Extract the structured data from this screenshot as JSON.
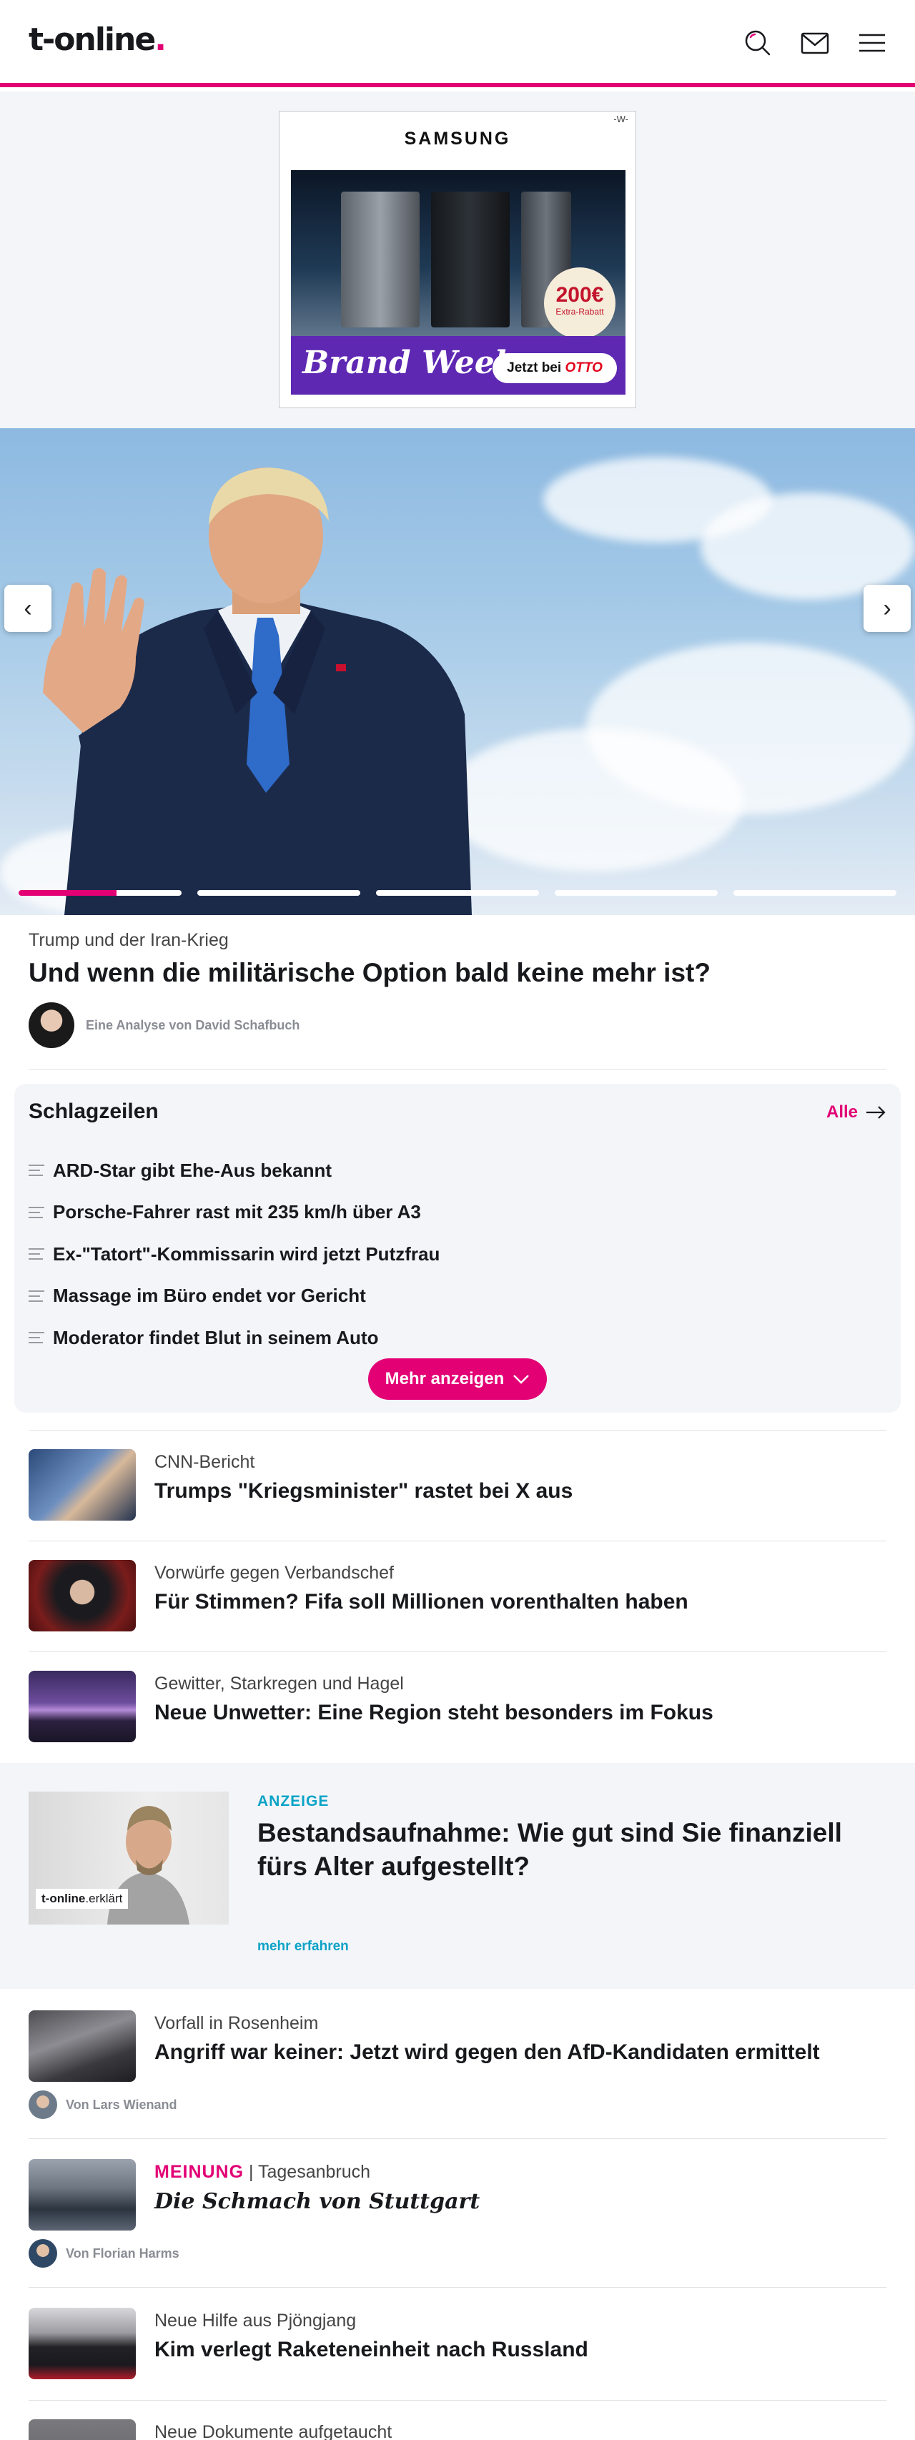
{
  "header": {
    "logo_text": "t-online",
    "logo_dot": ".",
    "icons": [
      "search-icon",
      "mail-icon",
      "menu-icon"
    ]
  },
  "ad": {
    "marker": "-W-",
    "brand": "SAMSUNG",
    "badge_value": "200€",
    "badge_text": "Extra-Rabatt",
    "campaign": "Brand Week",
    "cta_prefix": "Jetzt bei",
    "cta_brand": "OTTO"
  },
  "hero": {
    "slides_total": 5,
    "active_slide": 1,
    "active_progress": 0.6,
    "kicker": "Trump und der Iran-Krieg",
    "title": "Und wenn die militärische Option bald keine mehr ist?",
    "author": "Eine Analyse von David Schafbuch"
  },
  "headlines": {
    "heading": "Schlagzeilen",
    "all_label": "Alle",
    "items": [
      "ARD-Star gibt Ehe-Aus bekannt",
      "Porsche-Fahrer rast mit 235 km/h über A3",
      "Ex-\"Tatort\"-Kommissarin wird jetzt Putzfrau",
      "Massage im Büro endet vor Gericht",
      "Moderator findet Blut in seinem Auto"
    ],
    "more_label": "Mehr anzeigen"
  },
  "teasers": [
    {
      "kicker": "CNN-Bericht",
      "title": "Trumps \"Kriegsminister\" rastet bei X aus"
    },
    {
      "kicker": "Vorwürfe gegen Verbandschef",
      "title": "Für Stimmen? Fifa soll Millionen vorenthalten haben"
    },
    {
      "kicker": "Gewitter, Starkregen und Hagel",
      "title": "Neue Unwetter: Eine Region steht besonders im Fokus"
    }
  ],
  "sponsored": {
    "label": "ANZEIGE",
    "title": "Bestandsaufnahme: Wie gut sind Sie finanziell fürs Alter aufgestellt?",
    "link": "mehr erfahren",
    "image_tag_bold": "t-online",
    "image_tag_light": ".erklärt"
  },
  "articles": [
    {
      "kicker": "Vorfall in Rosenheim",
      "title": "Angriff war keiner: Jetzt wird gegen den AfD-Kandidaten ermittelt",
      "author": "Von Lars Wienand"
    },
    {
      "kicker_accent": "MEINUNG",
      "kicker_sep": " | ",
      "kicker": "Tagesanbruch",
      "title": "Die Schmach von Stuttgart",
      "author": "Von Florian Harms"
    },
    {
      "kicker": "Neue Hilfe aus Pjöngjang",
      "title": "Kim verlegt Raketeneinheit nach Russland"
    },
    {
      "kicker": "Neue Dokumente aufgetaucht"
    }
  ],
  "colors": {
    "brand": "#e20074",
    "sponsored_accent": "#0aa3c6",
    "muted_bg": "#f4f5f9"
  }
}
